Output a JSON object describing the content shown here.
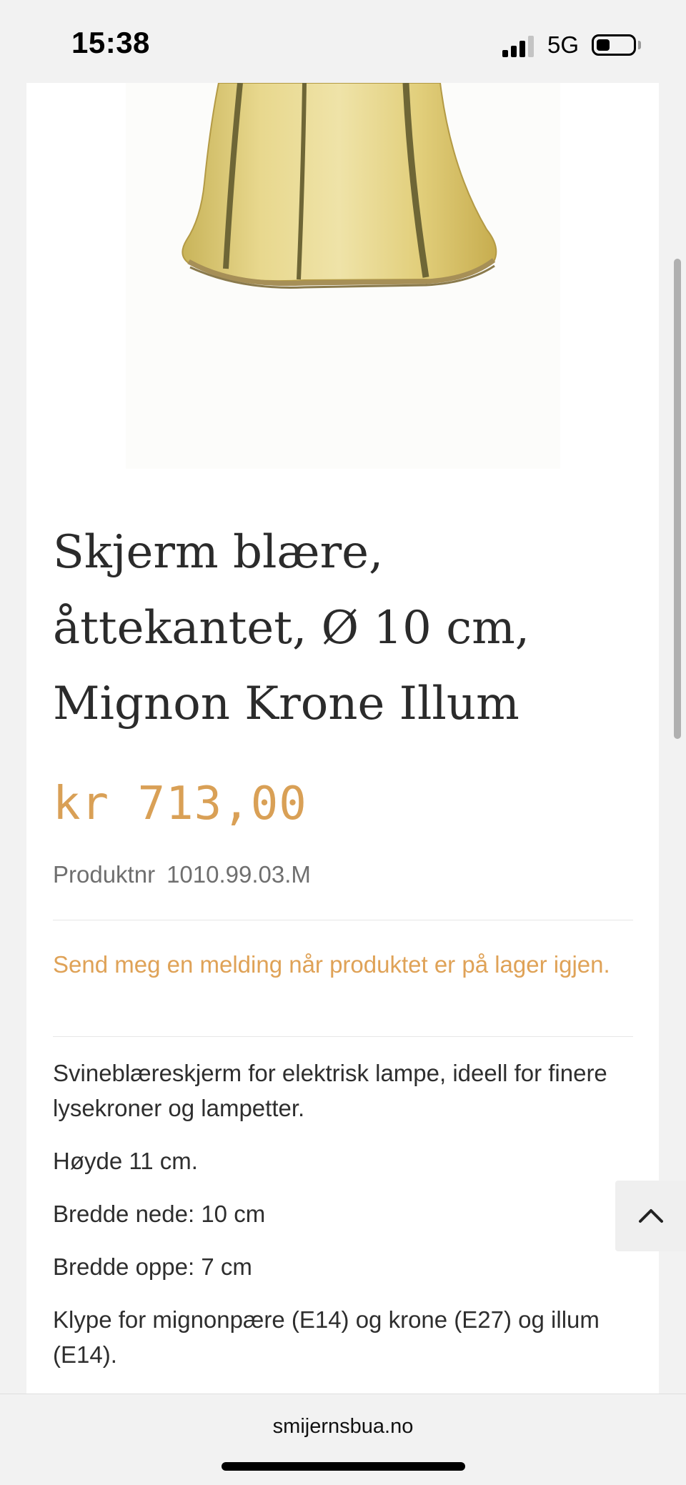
{
  "status_bar": {
    "time": "15:38",
    "network": "5G",
    "battery_level": 0.3
  },
  "product": {
    "title": "Skjerm blære, åttekantet, Ø 10 cm, Mignon Krone Illum",
    "price": "kr 713,00",
    "sku_label": "Produktnr",
    "sku_value": "1010.99.03.M",
    "notify_link": "Send meg en melding når produktet er på lager igjen.",
    "description": [
      "Svineblæreskjerm for elektrisk lampe, ideell for finere lysekroner og lampetter.",
      "Høyde 11 cm.",
      "Bredde nede: 10 cm",
      "Bredde oppe: 7 cm",
      "Klype for mignonpære (E14) og krone (E27) og illum (E14)."
    ]
  },
  "browser": {
    "url": "smijernsbua.no"
  },
  "icons": {
    "back_to_top": "chevron-up-icon",
    "signal": "signal-icon",
    "battery": "battery-icon"
  },
  "colors": {
    "price": "#d9a056",
    "link": "#dfa257",
    "text": "#2b2b2b"
  }
}
